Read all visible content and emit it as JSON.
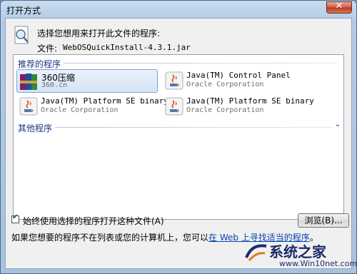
{
  "window": {
    "title": "打开方式",
    "close_symbol": "✕"
  },
  "header": {
    "prompt": "选择您想用来打开此文件的程序:",
    "file_label": "文件:",
    "file_name": "WebOSQuickInstall-4.3.1.jar"
  },
  "recommended": {
    "label": "推荐的程序",
    "programs": [
      {
        "name": "360压缩",
        "publisher": "360.cn",
        "icon": "winrar-books-icon"
      },
      {
        "name": "Java(TM) Control Panel",
        "publisher": "Oracle Corporation",
        "icon": "java-icon"
      },
      {
        "name": "Java(TM) Platform SE binary",
        "publisher": "Oracle Corporation",
        "icon": "java-icon"
      },
      {
        "name": "Java(TM) Platform SE binary",
        "publisher": "Oracle Corporation",
        "icon": "java-icon"
      }
    ]
  },
  "other": {
    "label": "其他程序",
    "chevron": "⌄"
  },
  "options": {
    "always_use_label": "始终使用选择的程序打开这种文件(A)",
    "always_use_checked": true,
    "browse_label": "浏览(B)..."
  },
  "footer": {
    "text": "如果您想要的程序不在列表或您的计算机上，您可以",
    "link_text": "在 Web 上寻找适当的程序",
    "suffix": "。"
  },
  "watermark": {
    "text": "系统之家",
    "url": "www.Win10net.com"
  }
}
